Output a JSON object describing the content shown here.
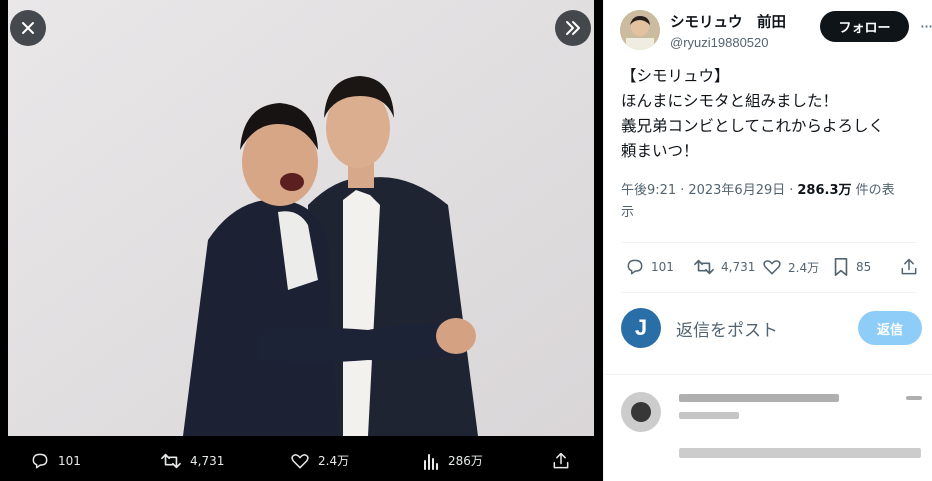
{
  "viewer": {
    "close_icon": "close-icon",
    "next_icon": "next-double-chevron-icon",
    "stats": {
      "replies": "101",
      "reposts": "4,731",
      "likes": "2.4万",
      "views": "286万"
    }
  },
  "tweet": {
    "display_name": "シモリュウ　前田",
    "handle": "@ryuzi19880520",
    "follow_label": "フォロー",
    "more_label": "···",
    "lines": [
      "【シモリュウ】",
      "ほんまにシモタと組みました！",
      "義兄弟コンビとしてこれからよろしく",
      "頼まいつ！"
    ],
    "time": "午後9:21",
    "date": "2023年6月29日",
    "views_count": "286.3万",
    "views_suffix": " 件の表",
    "views_suffix2": "示",
    "sep": "·",
    "actions": {
      "replies": "101",
      "reposts": "4,731",
      "likes": "2.4万",
      "bookmarks": "85"
    }
  },
  "reply": {
    "avatar_letter": "J",
    "placeholder": "返信をポスト",
    "button_label": "返信"
  },
  "colors": {
    "accent": "#1d9bf0",
    "reply_button": "#8ecdf8",
    "text_primary": "#0f1419",
    "text_secondary": "#536471"
  }
}
